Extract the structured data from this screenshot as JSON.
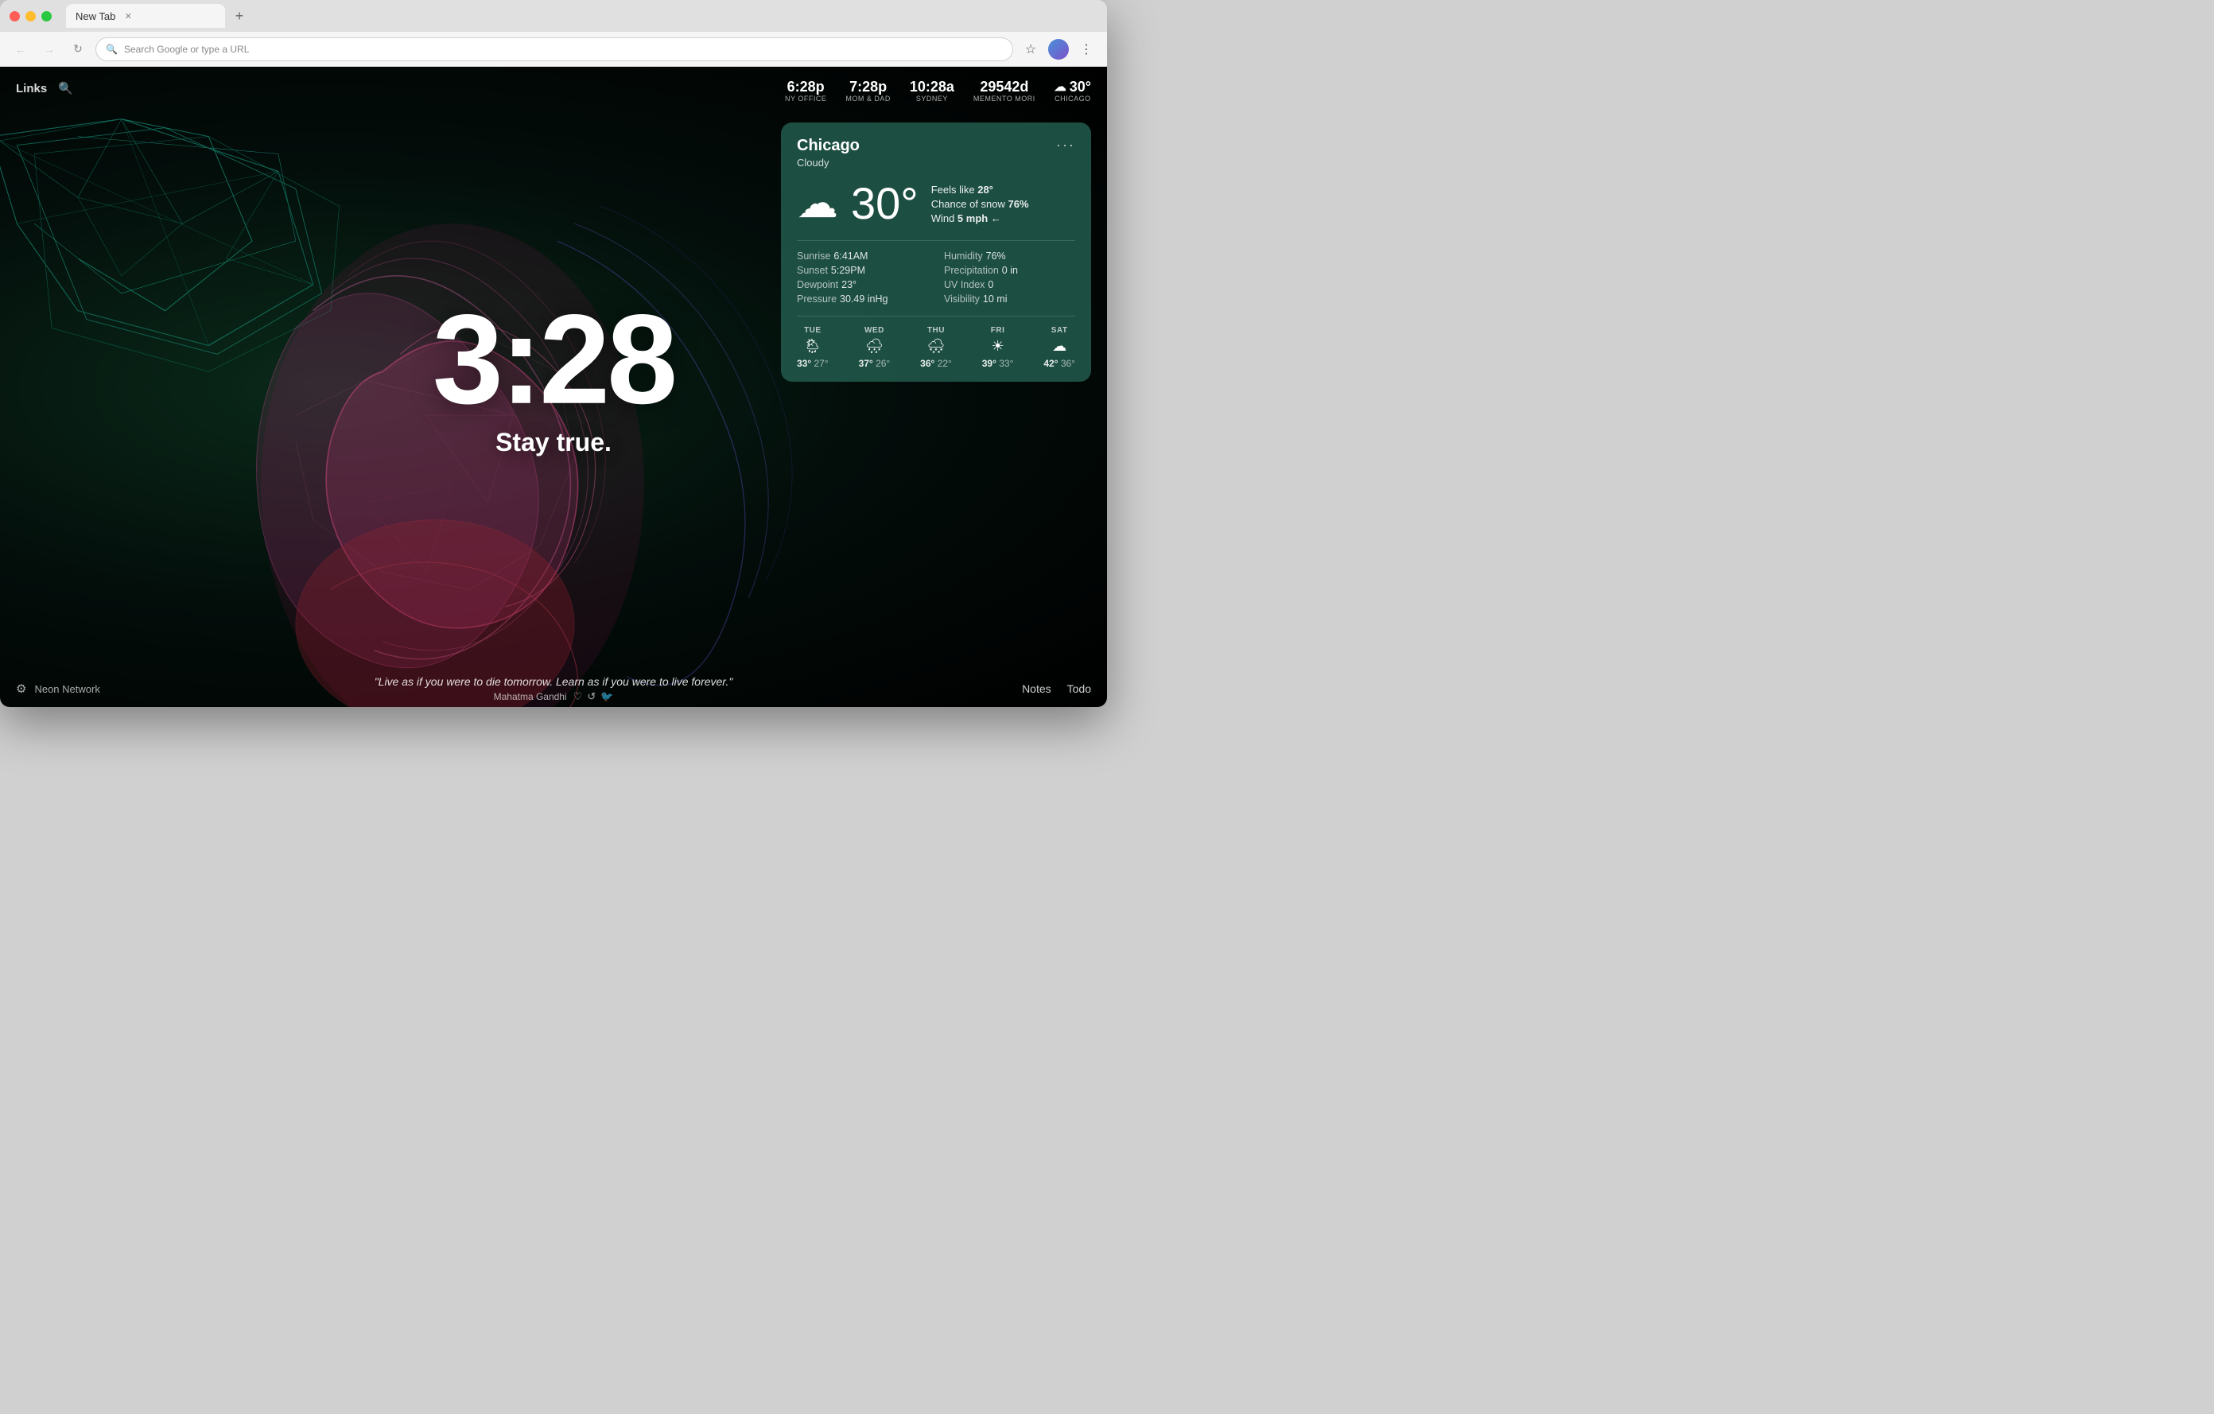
{
  "browser": {
    "tab_title": "New Tab",
    "address_placeholder": "Search Google or type a URL"
  },
  "top_nav": {
    "links_label": "Links",
    "search_label": "search"
  },
  "clocks": [
    {
      "time": "6:28p",
      "label": "NY OFFICE"
    },
    {
      "time": "7:28p",
      "label": "MOM & DAD"
    },
    {
      "time": "10:28a",
      "label": "SYDNEY"
    },
    {
      "time": "29542d",
      "label": "MEMENTO MORI"
    },
    {
      "time": "30°",
      "label": "CHICAGO",
      "icon": "☁"
    }
  ],
  "weather": {
    "city": "Chicago",
    "condition": "Cloudy",
    "temp": "30°",
    "feels_like": "28°",
    "chance_of_snow": "76%",
    "wind": "5 mph ←",
    "sunrise": "6:41AM",
    "sunset": "5:29PM",
    "dewpoint": "23°",
    "pressure": "30.49 inHg",
    "humidity": "76%",
    "precipitation": "0 in",
    "uv_index": "0",
    "visibility": "10 mi",
    "forecast": [
      {
        "day": "TUE",
        "icon": "🌦",
        "hi": "33°",
        "lo": "27°"
      },
      {
        "day": "WED",
        "icon": "🌧",
        "hi": "37°",
        "lo": "26°"
      },
      {
        "day": "THU",
        "icon": "🌨",
        "hi": "36°",
        "lo": "22°"
      },
      {
        "day": "FRI",
        "icon": "☀",
        "hi": "39°",
        "lo": "33°"
      },
      {
        "day": "SAT",
        "icon": "☁",
        "hi": "42°",
        "lo": "36°"
      }
    ]
  },
  "center": {
    "time": "3:28",
    "tagline": "Stay true."
  },
  "bottom": {
    "source_label": "Neon Network",
    "quote": "\"Live as if you were to die tomorrow. Learn as if you were to live forever.\"",
    "author": "Mahatma Gandhi",
    "notes_label": "Notes",
    "todo_label": "Todo"
  }
}
